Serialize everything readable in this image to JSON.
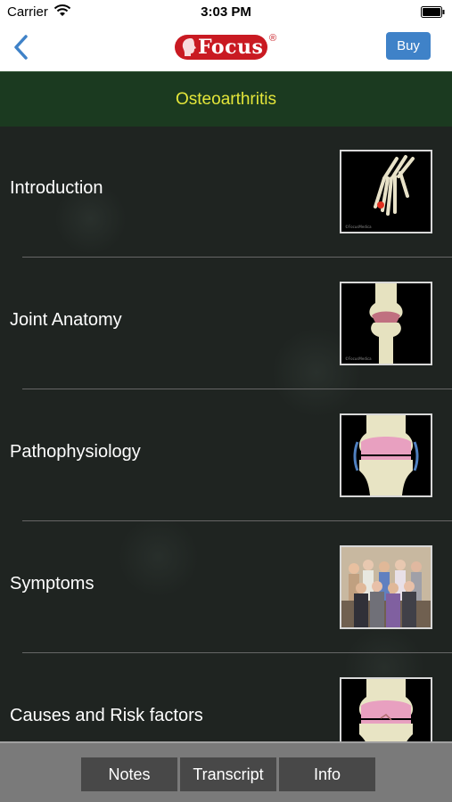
{
  "status_bar": {
    "carrier": "Carrier",
    "time": "3:03 PM"
  },
  "nav": {
    "logo_text": "Focus",
    "logo_reg": "®",
    "buy_label": "Buy"
  },
  "title": "Osteoarthritis",
  "topics": [
    {
      "label": "Introduction",
      "thumb": "hand-bones-thumbnail"
    },
    {
      "label": "Joint Anatomy",
      "thumb": "knee-joint-thumbnail"
    },
    {
      "label": "Pathophysiology",
      "thumb": "cartilage-thumbnail"
    },
    {
      "label": "Symptoms",
      "thumb": "elderly-group-thumbnail"
    },
    {
      "label": "Causes and Risk factors",
      "thumb": "knee-cartilage-thumbnail"
    }
  ],
  "tabs": {
    "notes": "Notes",
    "transcript": "Transcript",
    "info": "Info"
  },
  "colors": {
    "accent": "#3f82c8",
    "title_bar": "#1b3a20",
    "title_text": "#e4e63a",
    "brand": "#c91a22"
  }
}
